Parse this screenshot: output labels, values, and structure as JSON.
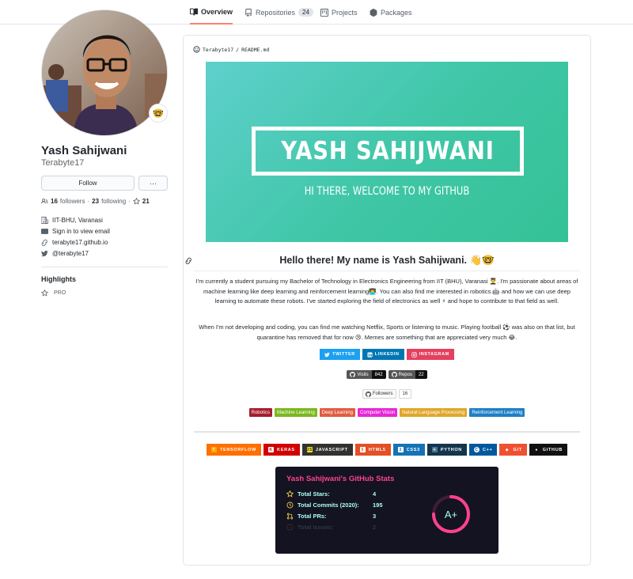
{
  "nav": {
    "tabs": [
      {
        "label": "Overview",
        "icon": "book-icon",
        "active": true
      },
      {
        "label": "Repositories",
        "icon": "repo-icon",
        "count": "24"
      },
      {
        "label": "Projects",
        "icon": "project-icon"
      },
      {
        "label": "Packages",
        "icon": "package-icon"
      }
    ]
  },
  "profile": {
    "fullname": "Yash Sahijwani",
    "username": "Terabyte17",
    "status_emoji": "🤓",
    "follow_label": "Follow",
    "more_label": "···",
    "followers_count": "16",
    "followers_label": "followers",
    "following_count": "23",
    "following_label": "following",
    "stars_count": "21",
    "organization": "IIT-BHU, Varanasi",
    "email": "Sign in to view email",
    "website": "terabyte17.github.io",
    "twitter": "@terabyte17",
    "highlights_title": "Highlights",
    "pro_label": "PRO"
  },
  "readme": {
    "path_user": "Terabyte17",
    "path_sep": " / ",
    "path_file": "README.md",
    "banner_title": "YASH SAHIJWANI",
    "banner_subtitle": "HI THERE, WELCOME TO MY GITHUB",
    "hello": "Hello there! My name is Yash Sahijwani. 👋🤓",
    "para1": "I'm currently a student pursuing my Bachelor of Technology in Electronics Engineering from IIT (BHU), Varanasi 👨‍🎓. I'm passionate about areas of machine learning like deep learning and reinforcement learning👨‍💻. You can also find me interested in robotics 🤖 and how we can use deep learning to automate these robots. I've started exploring the field of electronics as well ⚡ and hope to contribute to that field as well.",
    "para2": "When I'm not developing and coding, you can find me watching Netflix, Sports or listening to music. Playing football ⚽ was also on that list, but quarantine has removed that for now 😢. Memes are something that are appreciated very much 😂.",
    "social_badges": [
      {
        "label": "TWITTER",
        "color": "#1ca0f2",
        "icon": "twitter-icon"
      },
      {
        "label": "LINKEDIN",
        "color": "#0077b5",
        "icon": "linkedin-icon"
      },
      {
        "label": "INSTAGRAM",
        "color": "#e4405f",
        "icon": "instagram-icon"
      }
    ],
    "count_badges": [
      {
        "label": "Visits",
        "value": "842"
      },
      {
        "label": "Repos",
        "value": "22"
      }
    ],
    "followers_badge": {
      "label": "Followers",
      "value": "16"
    },
    "topics": [
      {
        "label": "Robotics",
        "color": "#a51d2d"
      },
      {
        "label": "Machine Learning",
        "color": "#7bb81f"
      },
      {
        "label": "Deep Learning",
        "color": "#e05d44"
      },
      {
        "label": "Computer Vision",
        "color": "#e528d6"
      },
      {
        "label": "Natural Language Processing",
        "color": "#dfa72a"
      },
      {
        "label": "Reinforcement Learning",
        "color": "#1e7fc5"
      }
    ],
    "tech": [
      {
        "label": "TENSORFLOW",
        "color": "#ff6f00",
        "icon": "tensorflow-icon",
        "glyph": "T"
      },
      {
        "label": "KERAS",
        "color": "#d00000",
        "icon": "keras-icon",
        "glyph": "K"
      },
      {
        "label": "JAVASCRIPT",
        "color": "#323330",
        "icon": "javascript-icon",
        "glyph": "JS"
      },
      {
        "label": "HTML5",
        "color": "#e34f26",
        "icon": "html5-icon",
        "glyph": "5"
      },
      {
        "label": "CSS3",
        "color": "#1572b6",
        "icon": "css3-icon",
        "glyph": "3"
      },
      {
        "label": "PYTHON",
        "color": "#14354c",
        "icon": "python-icon",
        "glyph": "✚"
      },
      {
        "label": "C++",
        "color": "#00599c",
        "icon": "cpp-icon",
        "glyph": "C"
      },
      {
        "label": "GIT",
        "color": "#f05032",
        "icon": "git-icon",
        "glyph": "◆"
      },
      {
        "label": "GITHUB",
        "color": "#121011",
        "icon": "github-icon",
        "glyph": "●"
      }
    ]
  },
  "stats_card": {
    "title": "Yash Sahijwani's GitHub Stats",
    "rows": [
      {
        "label": "Total Stars:",
        "value": "4",
        "icon": "star-icon"
      },
      {
        "label": "Total Commits (2020):",
        "value": "195",
        "icon": "clock-icon"
      },
      {
        "label": "Total PRs:",
        "value": "3",
        "icon": "pull-request-icon"
      },
      {
        "label": "Total Issues:",
        "value": "2",
        "icon": "issue-icon"
      }
    ],
    "grade": "A+",
    "grade_progress": 0.75,
    "colors": {
      "bg": "#141321",
      "title": "#fe428e",
      "text": "#a9fef7",
      "icon": "#f8d847",
      "ring": "#fe428e"
    }
  }
}
